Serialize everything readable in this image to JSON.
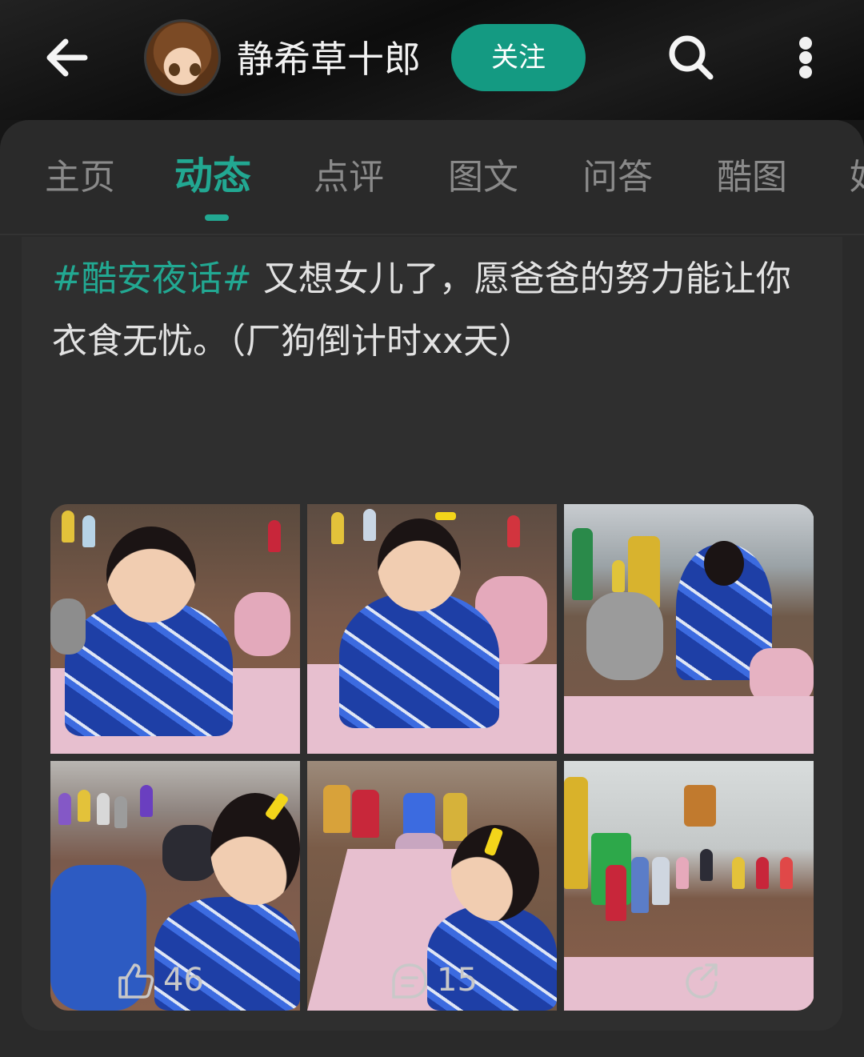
{
  "header": {
    "username": "静希草十郎",
    "follow_label": "关注"
  },
  "tabs": [
    {
      "label": "主页"
    },
    {
      "label": "动态"
    },
    {
      "label": "点评"
    },
    {
      "label": "图文"
    },
    {
      "label": "问答"
    },
    {
      "label": "酷图"
    },
    {
      "label": "好"
    }
  ],
  "active_tab": "动态",
  "post": {
    "hashtag": "#酷安夜话#",
    "text": " 又想女儿了，愿爸爸的努力能让你衣食无忧。（厂狗倒计时xx天）",
    "image_count": 6
  },
  "actions": {
    "likes": "46",
    "comments": "15"
  },
  "colors": {
    "accent": "#22a892",
    "follow_button": "#149a82",
    "panel": "#2a2a2a",
    "text": "#e2e2e2"
  },
  "icons": [
    "back-arrow-icon",
    "search-icon",
    "more-vertical-icon",
    "thumbs-up-icon",
    "comment-icon",
    "share-icon"
  ]
}
